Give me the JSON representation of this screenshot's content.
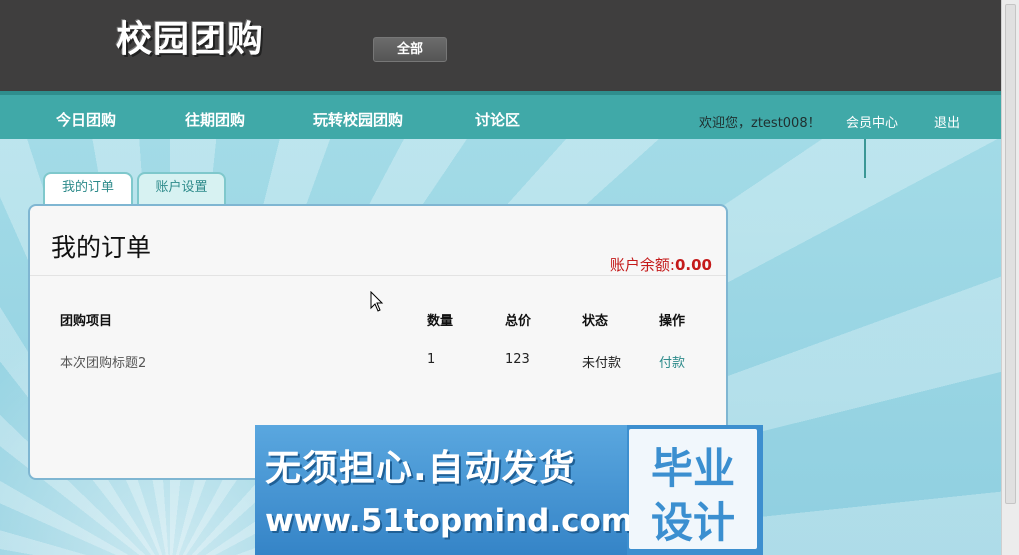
{
  "header": {
    "logo": "校园团购",
    "city_button": "全部"
  },
  "nav": {
    "items": [
      "今日团购",
      "往期团购",
      "玩转校园团购",
      "讨论区"
    ],
    "welcome": "欢迎您，ztest008！",
    "member_center": "会员中心",
    "logout": "退出"
  },
  "tabs": {
    "my_orders": "我的订单",
    "account_settings": "账户设置"
  },
  "panel": {
    "title": "我的订单",
    "balance_label": "账户余额:",
    "balance_value": "0.00"
  },
  "table": {
    "headers": [
      "团购项目",
      "数量",
      "总价",
      "状态",
      "操作"
    ],
    "rows": [
      {
        "item": "本次团购标题2",
        "qty": "1",
        "total": "123",
        "status": "未付款",
        "action": "付款"
      }
    ]
  },
  "ad": {
    "line1": "无须担心.自动发货",
    "line2": "www.51topmind.com",
    "box_line1": "毕业",
    "box_line2": "设计"
  },
  "colors": {
    "header_bg": "#3f3e3e",
    "nav_bg": "#40a9a8",
    "balance": "#c41a1a",
    "link": "#2e8b8b"
  }
}
